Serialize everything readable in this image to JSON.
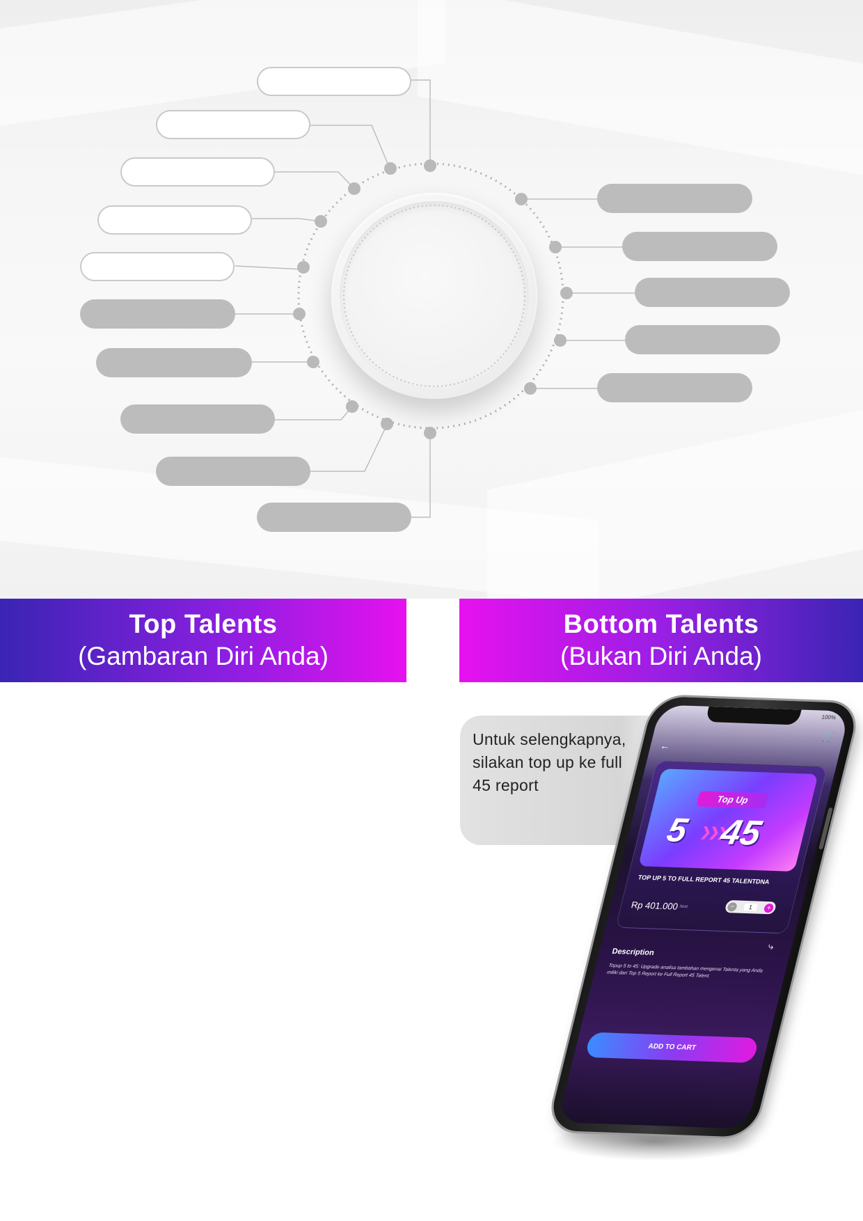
{
  "banners": {
    "top": {
      "title": "Top Talents",
      "subtitle": "(Gambaran Diri Anda)"
    },
    "bottom": {
      "title": "Bottom Talents",
      "subtitle": "(Bukan Diri Anda)"
    }
  },
  "bubble": {
    "text": "Untuk selengkapnya, silakan top up ke full 45 report"
  },
  "phone": {
    "status": "100%",
    "promo": {
      "label": "Top Up",
      "from": "5",
      "to": "45"
    },
    "product_title": "TOP UP 5 TO FULL REPORT 45 TALENTDNA",
    "price": "Rp 401.000",
    "price_note": "/test",
    "quantity": "1",
    "description_title": "Description",
    "description_text": "Topup 5 to 45: Upgrade analisa tambahan mengenai Talenta yang Anda miliki dari Top 5 Report ke Full Report 45 Talent.",
    "add_to_cart": "ADD TO CART"
  },
  "colors": {
    "banner_blue": "#3a24b4",
    "banner_magenta": "#e711ef",
    "pill_filled": "#bcbcbc",
    "pill_empty_border": "#c9c9c9"
  }
}
